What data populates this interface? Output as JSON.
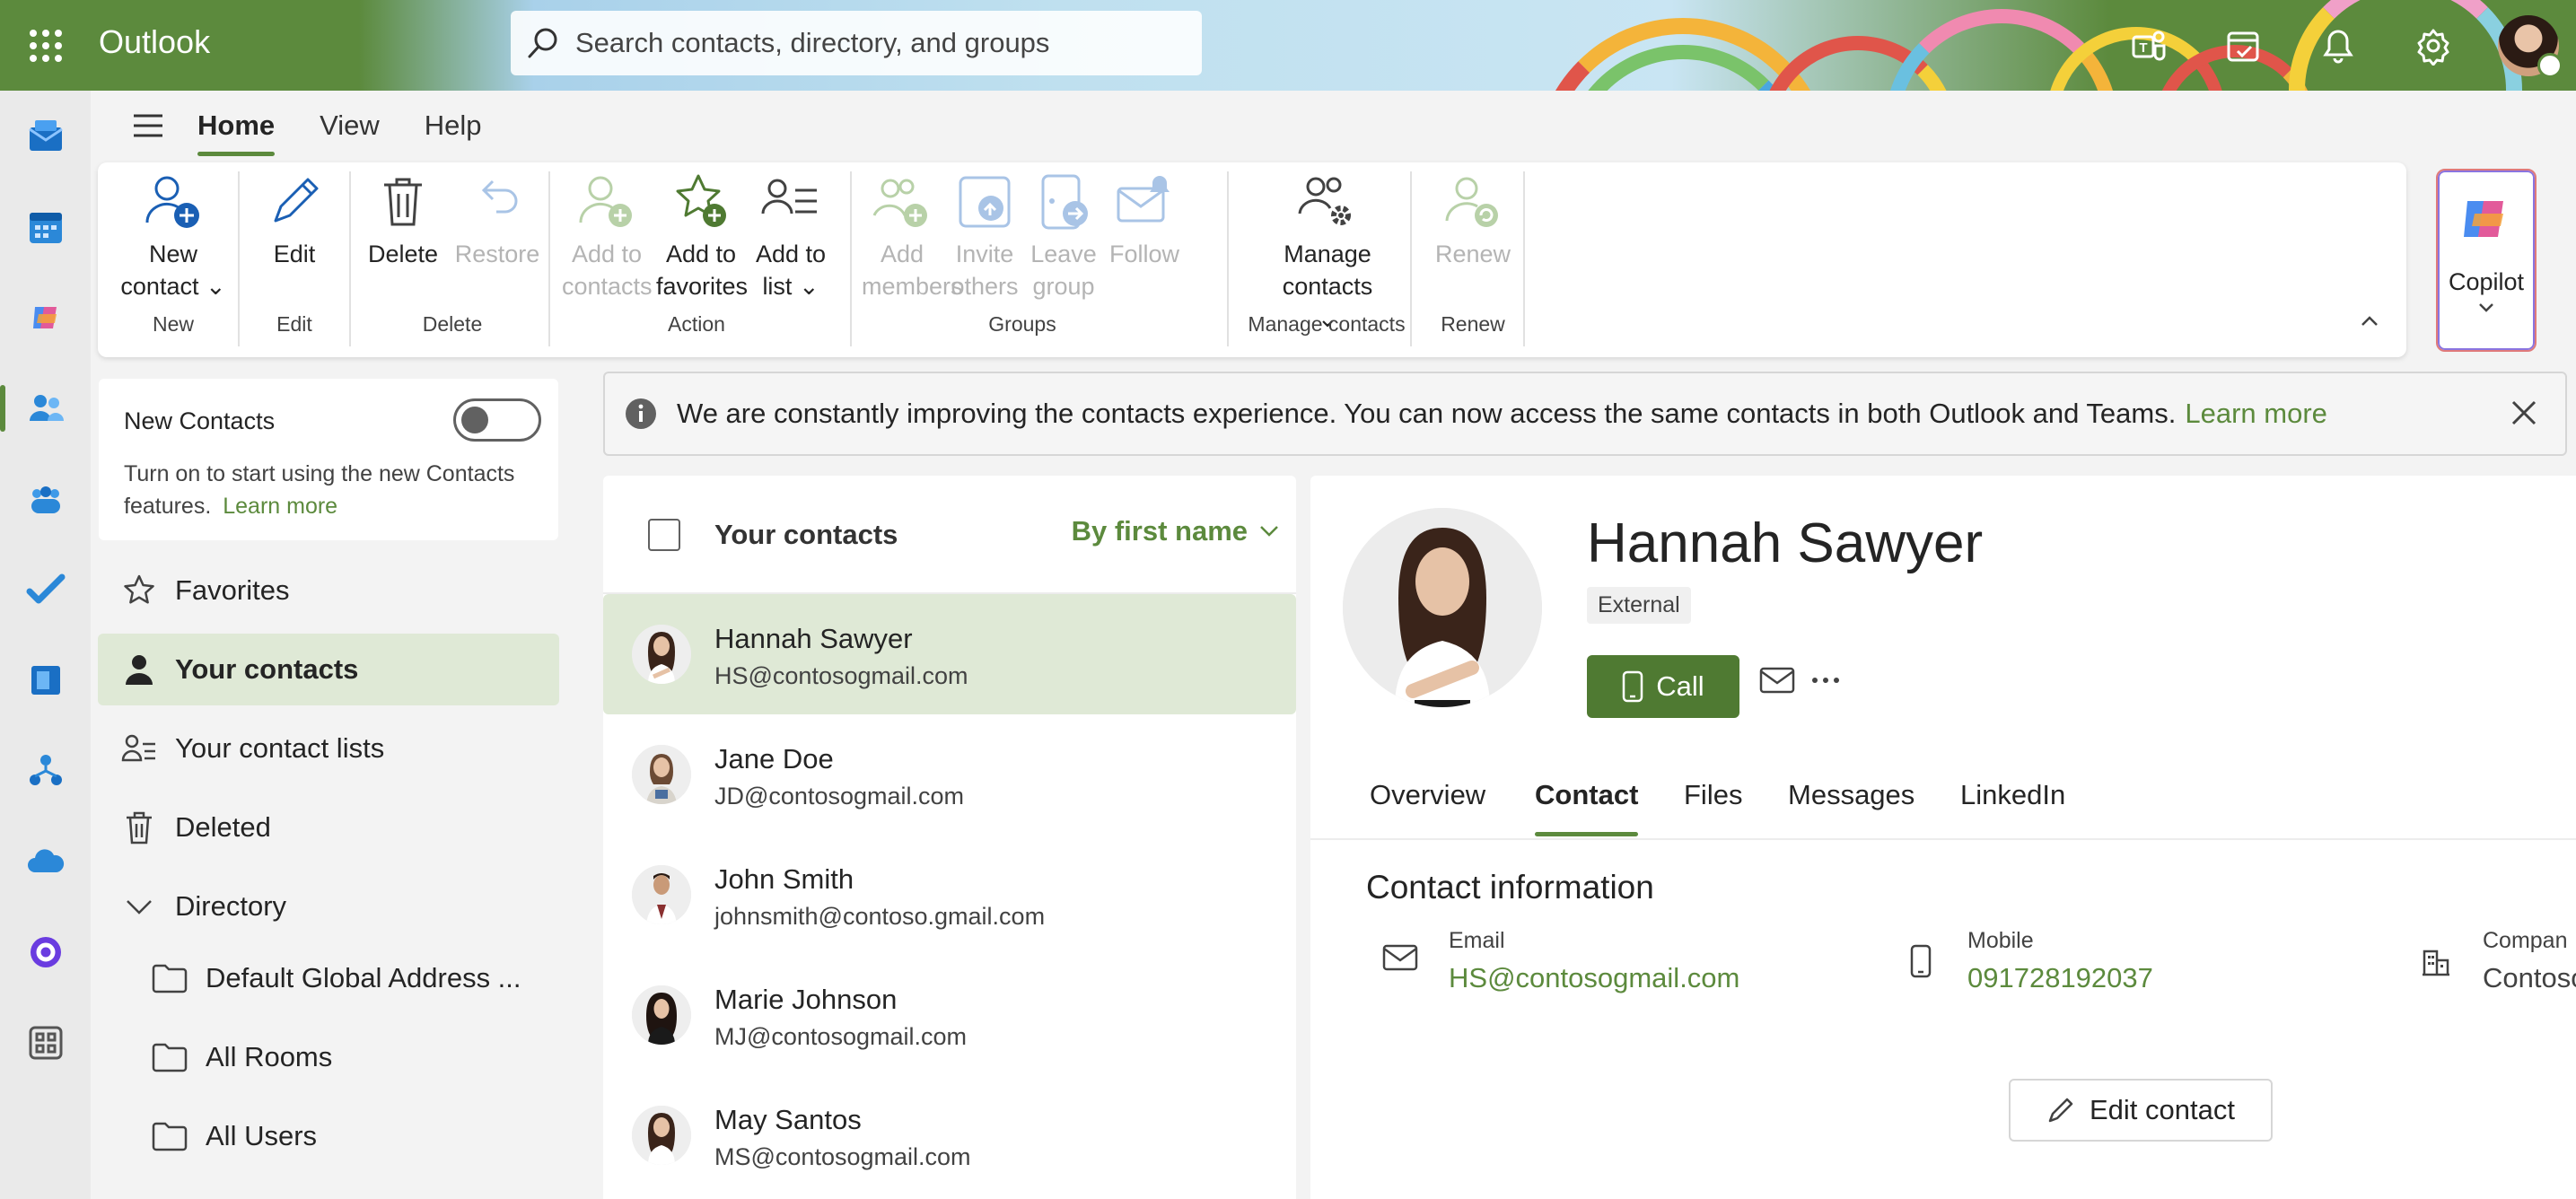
{
  "app": {
    "title": "Outlook"
  },
  "search": {
    "placeholder": "Search contacts, directory, and groups"
  },
  "ribbon_tabs": [
    "Home",
    "View",
    "Help"
  ],
  "ribbon": {
    "new_contact": "New contact",
    "group_new": "New",
    "edit": "Edit",
    "group_edit": "Edit",
    "delete": "Delete",
    "restore": "Restore",
    "group_delete": "Delete",
    "add_to_contacts": "Add to contacts",
    "add_to_favorites": "Add to favorites",
    "add_to_list": "Add to list",
    "group_action": "Action",
    "add_members": "Add members",
    "invite_others": "Invite others",
    "leave_group": "Leave group",
    "follow": "Follow",
    "group_groups": "Groups",
    "manage_contacts": "Manage contacts",
    "group_manage": "Manage contacts",
    "renew": "Renew",
    "group_renew": "Renew",
    "copilot": "Copilot"
  },
  "new_contacts_panel": {
    "title": "New Contacts",
    "toggle_on": false,
    "description": "Turn on to start using the new Contacts features.",
    "learn_more": "Learn more"
  },
  "nav": {
    "favorites": "Favorites",
    "your_contacts": "Your contacts",
    "your_contact_lists": "Your contact lists",
    "deleted": "Deleted",
    "directory": "Directory",
    "default_gal": "Default Global Address ...",
    "all_rooms": "All Rooms",
    "all_users": "All Users"
  },
  "infobar": {
    "text": "We are constantly improving the contacts experience. You can now access the same contacts in both Outlook and Teams.",
    "link": "Learn more"
  },
  "contact_list": {
    "title": "Your contacts",
    "sort": "By first name",
    "items": [
      {
        "name": "Hannah Sawyer",
        "email": "HS@contosogmail.com"
      },
      {
        "name": "Jane Doe",
        "email": "JD@contosogmail.com"
      },
      {
        "name": "John Smith",
        "email": "johnsmith@contoso.gmail.com"
      },
      {
        "name": "Marie Johnson",
        "email": "MJ@contosogmail.com"
      },
      {
        "name": "May Santos",
        "email": "MS@contosogmail.com"
      }
    ]
  },
  "detail": {
    "name": "Hannah Sawyer",
    "badge": "External",
    "call": "Call",
    "tabs": [
      "Overview",
      "Contact",
      "Files",
      "Messages",
      "LinkedIn"
    ],
    "section_title": "Contact information",
    "email_label": "Email",
    "email_value": "HS@contosogmail.com",
    "mobile_label": "Mobile",
    "mobile_value": "091728192037",
    "company_label": "Compan",
    "company_value": "Contoso",
    "edit_contact": "Edit contact"
  },
  "colors": {
    "brand": "#5c8a3d",
    "selected_bg": "#dfe9d6",
    "call_button": "#4f7a32"
  }
}
